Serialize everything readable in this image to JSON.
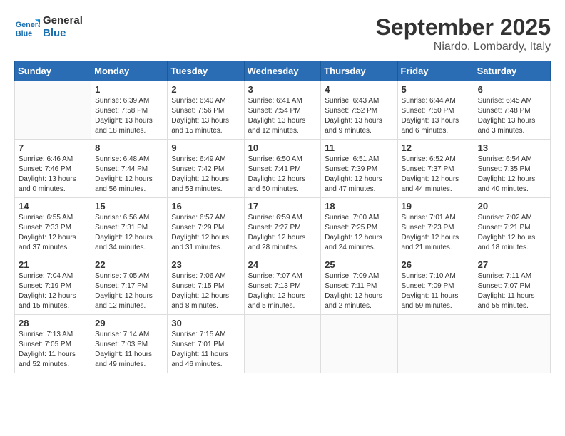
{
  "header": {
    "logo_line1": "General",
    "logo_line2": "Blue",
    "month": "September 2025",
    "location": "Niardo, Lombardy, Italy"
  },
  "weekdays": [
    "Sunday",
    "Monday",
    "Tuesday",
    "Wednesday",
    "Thursday",
    "Friday",
    "Saturday"
  ],
  "weeks": [
    [
      {
        "day": "",
        "sunrise": "",
        "sunset": "",
        "daylight": ""
      },
      {
        "day": "1",
        "sunrise": "Sunrise: 6:39 AM",
        "sunset": "Sunset: 7:58 PM",
        "daylight": "Daylight: 13 hours and 18 minutes."
      },
      {
        "day": "2",
        "sunrise": "Sunrise: 6:40 AM",
        "sunset": "Sunset: 7:56 PM",
        "daylight": "Daylight: 13 hours and 15 minutes."
      },
      {
        "day": "3",
        "sunrise": "Sunrise: 6:41 AM",
        "sunset": "Sunset: 7:54 PM",
        "daylight": "Daylight: 13 hours and 12 minutes."
      },
      {
        "day": "4",
        "sunrise": "Sunrise: 6:43 AM",
        "sunset": "Sunset: 7:52 PM",
        "daylight": "Daylight: 13 hours and 9 minutes."
      },
      {
        "day": "5",
        "sunrise": "Sunrise: 6:44 AM",
        "sunset": "Sunset: 7:50 PM",
        "daylight": "Daylight: 13 hours and 6 minutes."
      },
      {
        "day": "6",
        "sunrise": "Sunrise: 6:45 AM",
        "sunset": "Sunset: 7:48 PM",
        "daylight": "Daylight: 13 hours and 3 minutes."
      }
    ],
    [
      {
        "day": "7",
        "sunrise": "Sunrise: 6:46 AM",
        "sunset": "Sunset: 7:46 PM",
        "daylight": "Daylight: 13 hours and 0 minutes."
      },
      {
        "day": "8",
        "sunrise": "Sunrise: 6:48 AM",
        "sunset": "Sunset: 7:44 PM",
        "daylight": "Daylight: 12 hours and 56 minutes."
      },
      {
        "day": "9",
        "sunrise": "Sunrise: 6:49 AM",
        "sunset": "Sunset: 7:42 PM",
        "daylight": "Daylight: 12 hours and 53 minutes."
      },
      {
        "day": "10",
        "sunrise": "Sunrise: 6:50 AM",
        "sunset": "Sunset: 7:41 PM",
        "daylight": "Daylight: 12 hours and 50 minutes."
      },
      {
        "day": "11",
        "sunrise": "Sunrise: 6:51 AM",
        "sunset": "Sunset: 7:39 PM",
        "daylight": "Daylight: 12 hours and 47 minutes."
      },
      {
        "day": "12",
        "sunrise": "Sunrise: 6:52 AM",
        "sunset": "Sunset: 7:37 PM",
        "daylight": "Daylight: 12 hours and 44 minutes."
      },
      {
        "day": "13",
        "sunrise": "Sunrise: 6:54 AM",
        "sunset": "Sunset: 7:35 PM",
        "daylight": "Daylight: 12 hours and 40 minutes."
      }
    ],
    [
      {
        "day": "14",
        "sunrise": "Sunrise: 6:55 AM",
        "sunset": "Sunset: 7:33 PM",
        "daylight": "Daylight: 12 hours and 37 minutes."
      },
      {
        "day": "15",
        "sunrise": "Sunrise: 6:56 AM",
        "sunset": "Sunset: 7:31 PM",
        "daylight": "Daylight: 12 hours and 34 minutes."
      },
      {
        "day": "16",
        "sunrise": "Sunrise: 6:57 AM",
        "sunset": "Sunset: 7:29 PM",
        "daylight": "Daylight: 12 hours and 31 minutes."
      },
      {
        "day": "17",
        "sunrise": "Sunrise: 6:59 AM",
        "sunset": "Sunset: 7:27 PM",
        "daylight": "Daylight: 12 hours and 28 minutes."
      },
      {
        "day": "18",
        "sunrise": "Sunrise: 7:00 AM",
        "sunset": "Sunset: 7:25 PM",
        "daylight": "Daylight: 12 hours and 24 minutes."
      },
      {
        "day": "19",
        "sunrise": "Sunrise: 7:01 AM",
        "sunset": "Sunset: 7:23 PM",
        "daylight": "Daylight: 12 hours and 21 minutes."
      },
      {
        "day": "20",
        "sunrise": "Sunrise: 7:02 AM",
        "sunset": "Sunset: 7:21 PM",
        "daylight": "Daylight: 12 hours and 18 minutes."
      }
    ],
    [
      {
        "day": "21",
        "sunrise": "Sunrise: 7:04 AM",
        "sunset": "Sunset: 7:19 PM",
        "daylight": "Daylight: 12 hours and 15 minutes."
      },
      {
        "day": "22",
        "sunrise": "Sunrise: 7:05 AM",
        "sunset": "Sunset: 7:17 PM",
        "daylight": "Daylight: 12 hours and 12 minutes."
      },
      {
        "day": "23",
        "sunrise": "Sunrise: 7:06 AM",
        "sunset": "Sunset: 7:15 PM",
        "daylight": "Daylight: 12 hours and 8 minutes."
      },
      {
        "day": "24",
        "sunrise": "Sunrise: 7:07 AM",
        "sunset": "Sunset: 7:13 PM",
        "daylight": "Daylight: 12 hours and 5 minutes."
      },
      {
        "day": "25",
        "sunrise": "Sunrise: 7:09 AM",
        "sunset": "Sunset: 7:11 PM",
        "daylight": "Daylight: 12 hours and 2 minutes."
      },
      {
        "day": "26",
        "sunrise": "Sunrise: 7:10 AM",
        "sunset": "Sunset: 7:09 PM",
        "daylight": "Daylight: 11 hours and 59 minutes."
      },
      {
        "day": "27",
        "sunrise": "Sunrise: 7:11 AM",
        "sunset": "Sunset: 7:07 PM",
        "daylight": "Daylight: 11 hours and 55 minutes."
      }
    ],
    [
      {
        "day": "28",
        "sunrise": "Sunrise: 7:13 AM",
        "sunset": "Sunset: 7:05 PM",
        "daylight": "Daylight: 11 hours and 52 minutes."
      },
      {
        "day": "29",
        "sunrise": "Sunrise: 7:14 AM",
        "sunset": "Sunset: 7:03 PM",
        "daylight": "Daylight: 11 hours and 49 minutes."
      },
      {
        "day": "30",
        "sunrise": "Sunrise: 7:15 AM",
        "sunset": "Sunset: 7:01 PM",
        "daylight": "Daylight: 11 hours and 46 minutes."
      },
      {
        "day": "",
        "sunrise": "",
        "sunset": "",
        "daylight": ""
      },
      {
        "day": "",
        "sunrise": "",
        "sunset": "",
        "daylight": ""
      },
      {
        "day": "",
        "sunrise": "",
        "sunset": "",
        "daylight": ""
      },
      {
        "day": "",
        "sunrise": "",
        "sunset": "",
        "daylight": ""
      }
    ]
  ]
}
